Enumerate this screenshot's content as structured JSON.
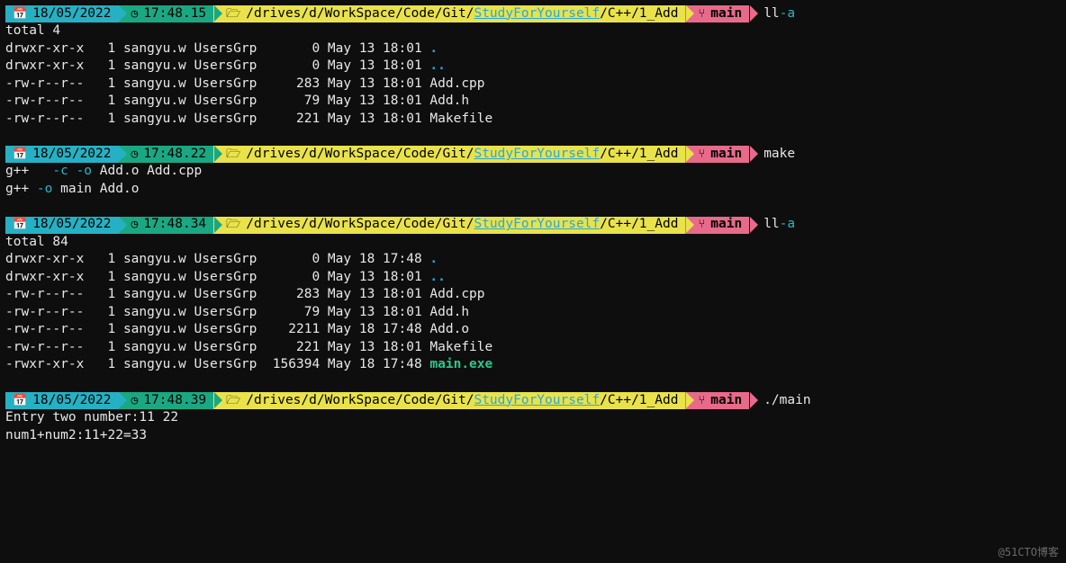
{
  "watermark": "@51CTO博客",
  "icons": {
    "cal": "📅",
    "clock": "◷",
    "folder": "🗁",
    "branch": "⑂"
  },
  "prompts": [
    {
      "date": "18/05/2022",
      "time": "17:48.15",
      "path_pre": "/drives/d/WorkSpace/Code/Git/",
      "path_link": "StudyForYourself",
      "path_post": "/C++/1_Add",
      "branch": "main",
      "cmd": "ll",
      "cmd_opt": " -a"
    },
    {
      "date": "18/05/2022",
      "time": "17:48.22",
      "path_pre": "/drives/d/WorkSpace/Code/Git/",
      "path_link": "StudyForYourself",
      "path_post": "/C++/1_Add",
      "branch": "main",
      "cmd": "make",
      "cmd_opt": ""
    },
    {
      "date": "18/05/2022",
      "time": "17:48.34",
      "path_pre": "/drives/d/WorkSpace/Code/Git/",
      "path_link": "StudyForYourself",
      "path_post": "/C++/1_Add",
      "branch": "main",
      "cmd": "ll",
      "cmd_opt": " -a"
    },
    {
      "date": "18/05/2022",
      "time": "17:48.39",
      "path_pre": "/drives/d/WorkSpace/Code/Git/",
      "path_link": "StudyForYourself",
      "path_post": "/C++/1_Add",
      "branch": "main",
      "cmd": "./main",
      "cmd_opt": ""
    }
  ],
  "ls1": {
    "total": "total 4",
    "rows": [
      {
        "perm": "drwxr-xr-x",
        "n": "1",
        "u": "sangyu.w",
        "g": "UsersGrp",
        "sz": "0",
        "date": "May 13 18:01",
        "name": ".",
        "cls": "dir"
      },
      {
        "perm": "drwxr-xr-x",
        "n": "1",
        "u": "sangyu.w",
        "g": "UsersGrp",
        "sz": "0",
        "date": "May 13 18:01",
        "name": "..",
        "cls": "dir"
      },
      {
        "perm": "-rw-r--r--",
        "n": "1",
        "u": "sangyu.w",
        "g": "UsersGrp",
        "sz": "283",
        "date": "May 13 18:01",
        "name": "Add.cpp",
        "cls": ""
      },
      {
        "perm": "-rw-r--r--",
        "n": "1",
        "u": "sangyu.w",
        "g": "UsersGrp",
        "sz": "79",
        "date": "May 13 18:01",
        "name": "Add.h",
        "cls": ""
      },
      {
        "perm": "-rw-r--r--",
        "n": "1",
        "u": "sangyu.w",
        "g": "UsersGrp",
        "sz": "221",
        "date": "May 13 18:01",
        "name": "Makefile",
        "cls": ""
      }
    ]
  },
  "make_out": [
    {
      "pre": "g++   ",
      "opt": "-c -o",
      "post": " Add.o Add.cpp"
    },
    {
      "pre": "g++ ",
      "opt": "-o",
      "post": " main Add.o"
    }
  ],
  "ls2": {
    "total": "total 84",
    "rows": [
      {
        "perm": "drwxr-xr-x",
        "n": "1",
        "u": "sangyu.w",
        "g": "UsersGrp",
        "sz": "0",
        "date": "May 18 17:48",
        "name": ".",
        "cls": "dir"
      },
      {
        "perm": "drwxr-xr-x",
        "n": "1",
        "u": "sangyu.w",
        "g": "UsersGrp",
        "sz": "0",
        "date": "May 13 18:01",
        "name": "..",
        "cls": "dir"
      },
      {
        "perm": "-rw-r--r--",
        "n": "1",
        "u": "sangyu.w",
        "g": "UsersGrp",
        "sz": "283",
        "date": "May 13 18:01",
        "name": "Add.cpp",
        "cls": ""
      },
      {
        "perm": "-rw-r--r--",
        "n": "1",
        "u": "sangyu.w",
        "g": "UsersGrp",
        "sz": "79",
        "date": "May 13 18:01",
        "name": "Add.h",
        "cls": ""
      },
      {
        "perm": "-rw-r--r--",
        "n": "1",
        "u": "sangyu.w",
        "g": "UsersGrp",
        "sz": "2211",
        "date": "May 18 17:48",
        "name": "Add.o",
        "cls": ""
      },
      {
        "perm": "-rw-r--r--",
        "n": "1",
        "u": "sangyu.w",
        "g": "UsersGrp",
        "sz": "221",
        "date": "May 13 18:01",
        "name": "Makefile",
        "cls": ""
      },
      {
        "perm": "-rwxr-xr-x",
        "n": "1",
        "u": "sangyu.w",
        "g": "UsersGrp",
        "sz": "156394",
        "date": "May 18 17:48",
        "name": "main.exe",
        "cls": "exe"
      }
    ]
  },
  "run_out": [
    "Entry two number:11 22",
    "num1+num2:11+22=33"
  ]
}
